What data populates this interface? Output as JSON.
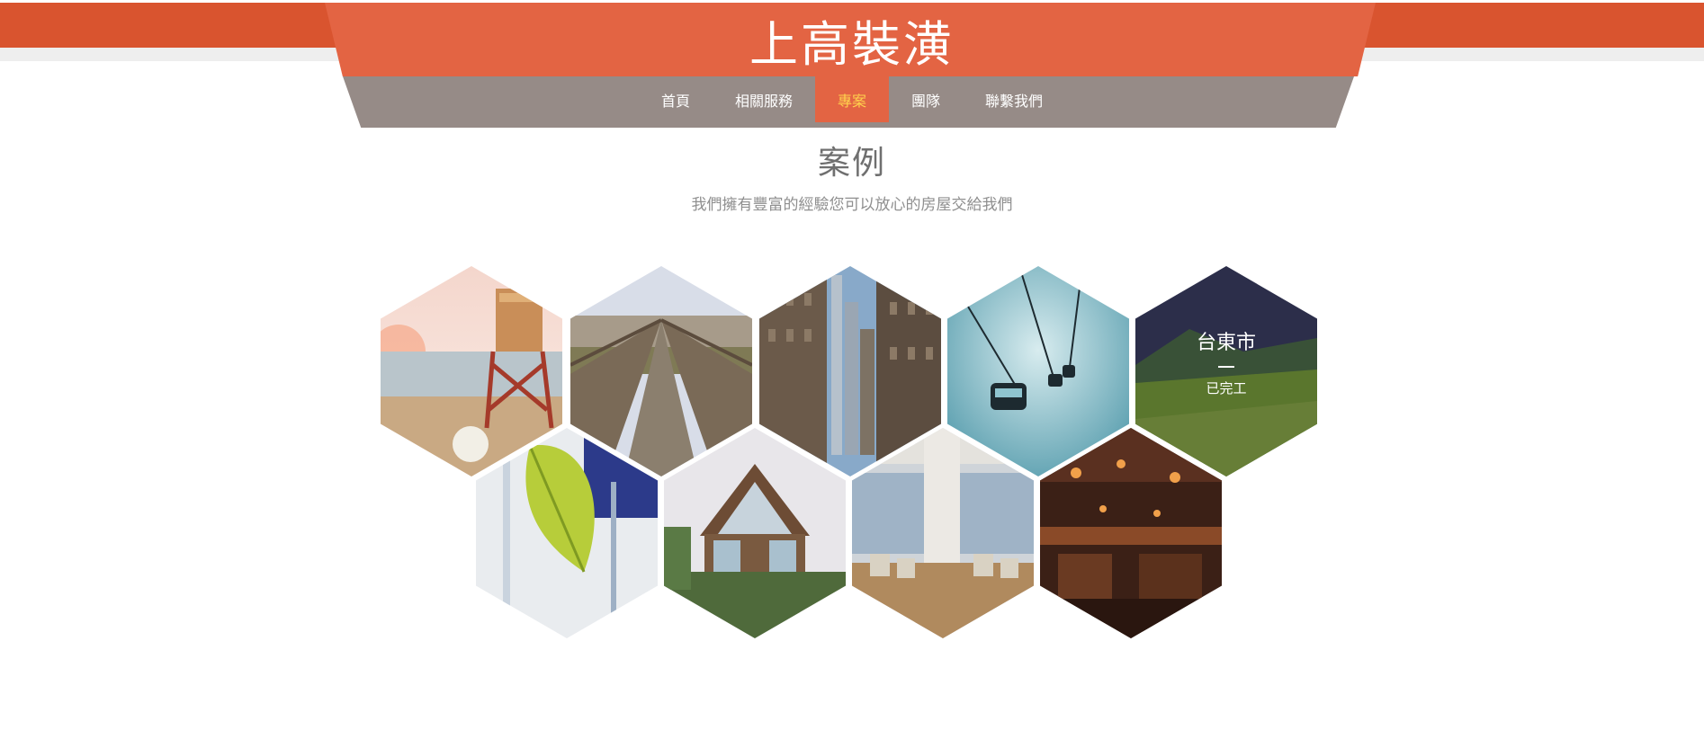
{
  "site": {
    "title": "上高裝潢"
  },
  "nav": {
    "items": [
      {
        "label": "首頁",
        "active": false
      },
      {
        "label": "相關服務",
        "active": false
      },
      {
        "label": "專案",
        "active": true
      },
      {
        "label": "團隊",
        "active": false
      },
      {
        "label": "聯繫我們",
        "active": false
      }
    ]
  },
  "section": {
    "title": "案例",
    "subtitle": "我們擁有豐富的經驗您可以放心的房屋交給我們"
  },
  "projects": [
    {
      "image": "beach-lifeguard-tower"
    },
    {
      "image": "wooden-boardwalk"
    },
    {
      "image": "city-buildings"
    },
    {
      "image": "cable-car"
    },
    {
      "image": "green-hills",
      "location": "台東市",
      "status": "已完工"
    },
    {
      "image": "green-leaf"
    },
    {
      "image": "wooden-house"
    },
    {
      "image": "hotel-lobby"
    },
    {
      "image": "restaurant-interior"
    }
  ],
  "colors": {
    "primary": "#e36443",
    "primary_dark": "#d9542f",
    "nav_bg": "#968b87",
    "active_text": "#ffd34d"
  }
}
